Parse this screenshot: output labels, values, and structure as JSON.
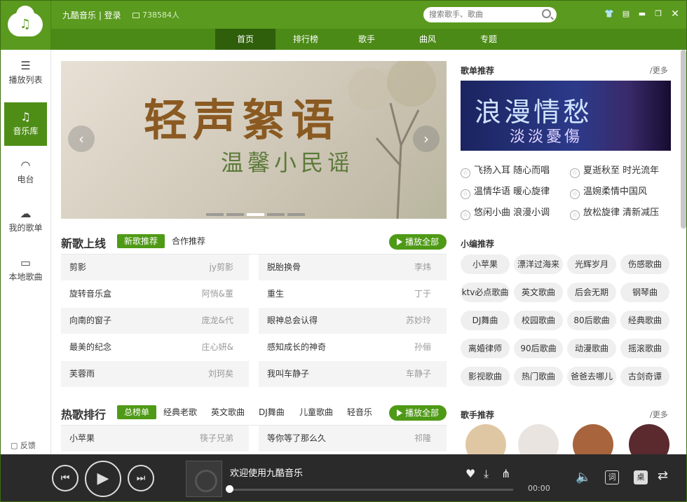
{
  "header": {
    "brand": "九酷音乐 | 登录",
    "online": "738584人",
    "search_placeholder": "搜索歌手、歌曲"
  },
  "nav": [
    "首页",
    "排行榜",
    "歌手",
    "曲风",
    "专题"
  ],
  "sidebar": [
    {
      "label": "播放列表",
      "icon": "list-icon"
    },
    {
      "label": "音乐库",
      "icon": "music-note-icon"
    },
    {
      "label": "电台",
      "icon": "wifi-icon"
    },
    {
      "label": "我的歌单",
      "icon": "cloud-icon"
    },
    {
      "label": "本地歌曲",
      "icon": "monitor-icon"
    }
  ],
  "feedback": "反馈",
  "banner": {
    "title": "轻声絮语",
    "subtitle": "温馨小民谣"
  },
  "new_songs": {
    "title": "新歌上线",
    "tab_active": "新歌推荐",
    "tab2": "合作推荐",
    "play_all": "播放全部",
    "rows": [
      [
        {
          "name": "剪影",
          "artist": "jy剪影"
        },
        {
          "name": "脱胎换骨",
          "artist": "李炜"
        }
      ],
      [
        {
          "name": "旋转音乐盒",
          "artist": "阿悄&董"
        },
        {
          "name": "重生",
          "artist": "丁于"
        }
      ],
      [
        {
          "name": "向南的窗子",
          "artist": "庞龙&代"
        },
        {
          "name": "眼神总会认得",
          "artist": "苏妙玲"
        }
      ],
      [
        {
          "name": "最美的纪念",
          "artist": "庄心妍&"
        },
        {
          "name": "感知成长的神奇",
          "artist": "孙俪"
        }
      ],
      [
        {
          "name": "芙蓉雨",
          "artist": "刘珂矣"
        },
        {
          "name": "我叫车静子",
          "artist": "车静子"
        }
      ]
    ]
  },
  "hot": {
    "title": "热歌排行",
    "tabs": [
      "总榜单",
      "经典老歌",
      "英文歌曲",
      "DJ舞曲",
      "儿童歌曲",
      "轻音乐"
    ],
    "play_all": "播放全部",
    "row": [
      {
        "name": "小苹果",
        "artist": "筷子兄弟"
      },
      {
        "name": "等你等了那么久",
        "artist": "祁隆"
      }
    ]
  },
  "playlist_rec": {
    "title": "歌单推荐",
    "more": "/更多",
    "image_title": "浪漫情愁",
    "image_sub": "淡淡憂傷",
    "items": [
      "飞扬入耳 随心而唱",
      "夏逝秋至 时光流年",
      "温情华语 暖心旋律",
      "温婉柔情中国风",
      "悠闲小曲 浪漫小调",
      "放松旋律 清新减压"
    ]
  },
  "editor_rec": {
    "title": "小编推荐",
    "chips": [
      "小苹果",
      "漂洋过海来",
      "光辉岁月",
      "伤感歌曲",
      "ktv必点歌曲",
      "英文歌曲",
      "后会无期",
      "钢琴曲",
      "DJ舞曲",
      "校园歌曲",
      "80后歌曲",
      "经典歌曲",
      "离婚律师",
      "90后歌曲",
      "动漫歌曲",
      "摇滚歌曲",
      "影视歌曲",
      "热门歌曲",
      "爸爸去哪儿",
      "古剑奇谭"
    ]
  },
  "singer_rec": {
    "title": "歌手推荐",
    "more": "/更多"
  },
  "player": {
    "title": "欢迎使用九酷音乐",
    "time": "00:00",
    "lyric": "词",
    "desktop": "桌",
    "progress": 0
  }
}
